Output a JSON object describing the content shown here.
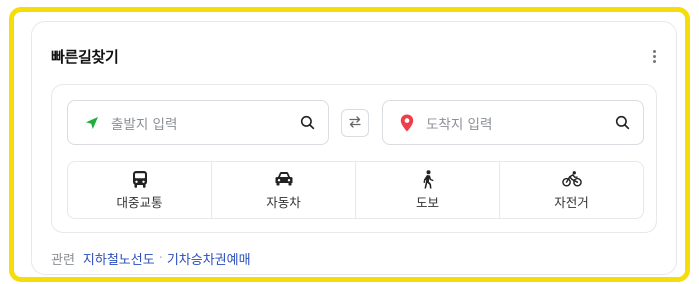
{
  "widget": {
    "title": "빠른길찾기",
    "more_icon": "more-vertical-icon"
  },
  "search": {
    "start_placeholder": "출발지 입력",
    "end_placeholder": "도착지 입력",
    "start_icon": "green-arrow-icon",
    "end_icon": "red-pin-icon",
    "search_icon": "magnifier-icon",
    "swap_icon": "swap-arrows-icon"
  },
  "modes": [
    {
      "label": "대중교통",
      "icon": "bus-icon"
    },
    {
      "label": "자동차",
      "icon": "car-icon"
    },
    {
      "label": "도보",
      "icon": "walk-icon"
    },
    {
      "label": "자전거",
      "icon": "bike-icon"
    }
  ],
  "related": {
    "prefix": "관련",
    "links": [
      "지하철노선도",
      "기차승차권예매"
    ],
    "separator": "·"
  },
  "colors": {
    "frame_border": "#f5dd0a",
    "start_icon": "#1fad3f",
    "end_icon": "#ef3e4a",
    "link": "#2a4ebd"
  }
}
